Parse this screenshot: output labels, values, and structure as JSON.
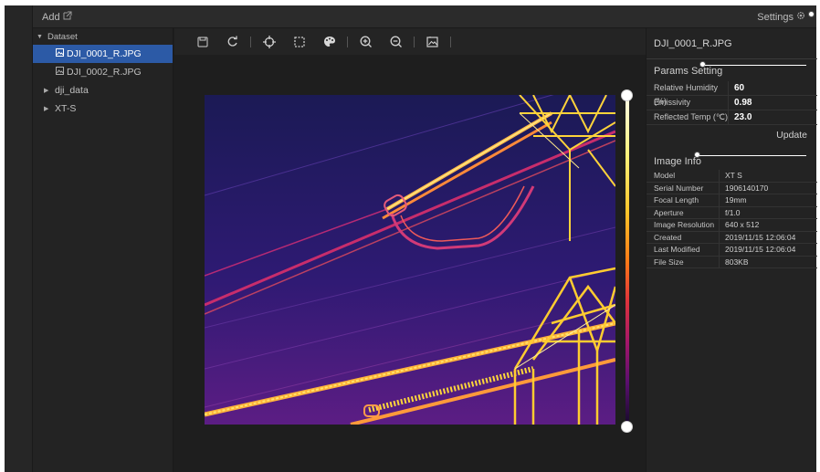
{
  "topbar": {
    "add_label": "Add",
    "settings_label": "Settings"
  },
  "sidebar": {
    "root_label": "Dataset",
    "items": [
      {
        "label": "DJI_0001_R.JPG",
        "type": "file",
        "selected": true
      },
      {
        "label": "DJI_0002_R.JPG",
        "type": "file",
        "selected": false
      },
      {
        "label": "dji_data",
        "type": "folder"
      },
      {
        "label": "XT-S",
        "type": "folder"
      }
    ]
  },
  "toolbar": {
    "tools": [
      "save-icon",
      "rotate-icon",
      "crosshair-icon",
      "select-area-icon",
      "palette-icon",
      "zoom-in-icon",
      "zoom-out-icon",
      "image-icon"
    ]
  },
  "panel": {
    "filename": "DJI_0001_R.JPG",
    "params_title": "Params Setting",
    "params": [
      {
        "key": "Relative Humidity (%)",
        "value": "60"
      },
      {
        "key": "Emissivity",
        "value": "0.98"
      },
      {
        "key": "Reflected Temp (℃)",
        "value": "23.0"
      }
    ],
    "update_label": "Update",
    "info_title": "Image Info",
    "info": [
      {
        "key": "Model",
        "value": "XT S"
      },
      {
        "key": "Serial Number",
        "value": "1906140170"
      },
      {
        "key": "Focal Length",
        "value": "19mm"
      },
      {
        "key": "Aperture",
        "value": "f/1.0"
      },
      {
        "key": "Image Resolution",
        "value": "640 x 512"
      },
      {
        "key": "Created",
        "value": "2019/11/15 12:06:04"
      },
      {
        "key": "Last Modified",
        "value": "2019/11/15 12:06:04"
      },
      {
        "key": "File Size",
        "value": "803KB"
      }
    ]
  },
  "colors": {
    "selected": "#2c5aa6",
    "background": "#1e1e1e",
    "panel": "#232323"
  }
}
